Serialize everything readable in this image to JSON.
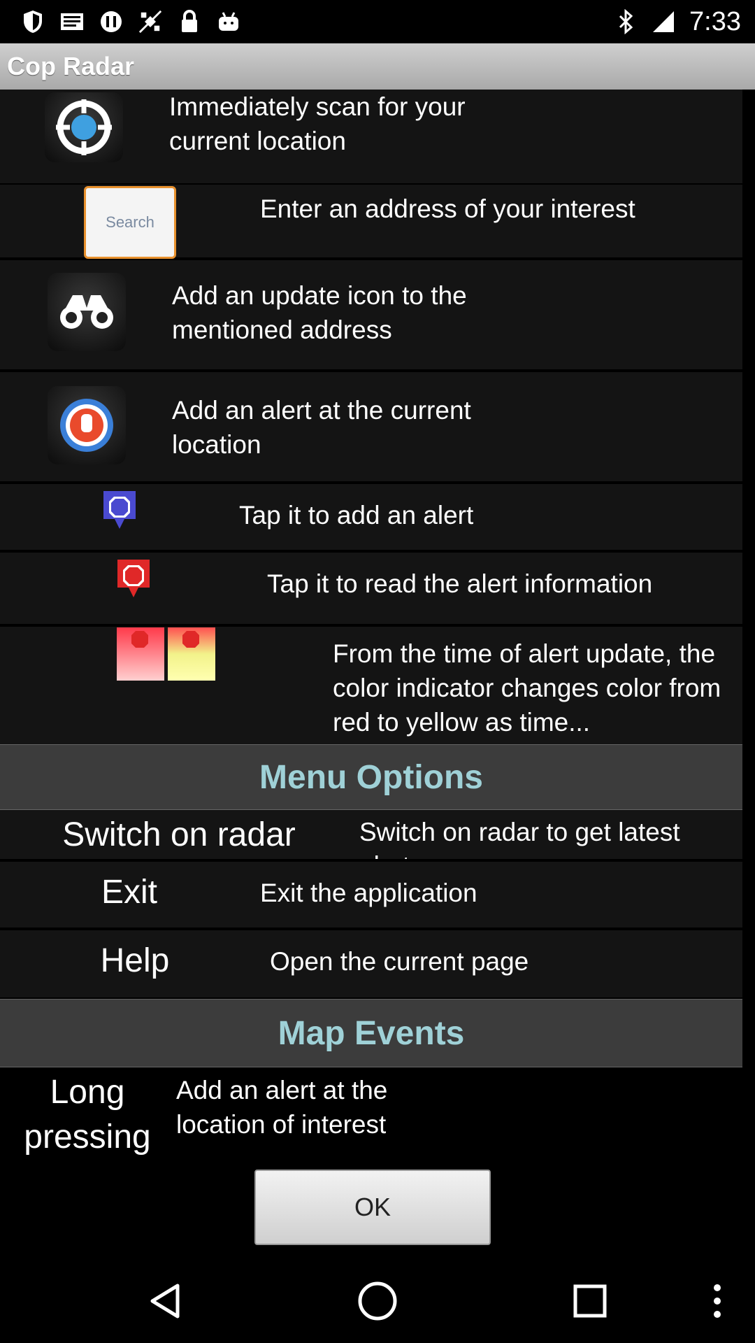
{
  "status_bar": {
    "time": "7:33",
    "left_icons": [
      "shield-icon",
      "mail-icon",
      "sync-icon",
      "gps-off-icon",
      "lock-icon",
      "android-icon"
    ],
    "right_icons": [
      "bluetooth-icon",
      "signal-icon"
    ]
  },
  "app": {
    "title": "Cop Radar"
  },
  "features": [
    {
      "icon": "radar-target-icon",
      "text": "Immediately scan for your current location"
    },
    {
      "icon": "search-button-icon",
      "icon_label": "Search",
      "text": "Enter an address of your interest"
    },
    {
      "icon": "binoculars-icon",
      "text": "Add an update icon to the mentioned address"
    },
    {
      "icon": "hand-stop-icon",
      "text": "Add an alert at the current location"
    },
    {
      "icon": "stop-marker-blue-icon",
      "text": "Tap it to add an alert"
    },
    {
      "icon": "stop-marker-red-icon",
      "text": "Tap it to read the alert information"
    },
    {
      "icon": "color-indicator-icons",
      "text": "From the time of alert update, the color indicator changes color from red to yellow as time..."
    }
  ],
  "menu_options": {
    "title": "Menu Options",
    "items": [
      {
        "name": "Switch on radar",
        "desc": "Switch on radar to get latest alerts"
      },
      {
        "name": "Exit",
        "desc": "Exit the application"
      },
      {
        "name": "Help",
        "desc": "Open the current page"
      }
    ]
  },
  "map_events": {
    "title": "Map Events",
    "items": [
      {
        "name": "Long pressing",
        "desc": "Add an alert at the location of interest"
      }
    ]
  },
  "ok_button": {
    "label": "OK"
  },
  "nav_bar": {
    "buttons": [
      "back-icon",
      "home-icon",
      "recents-icon",
      "overflow-menu-icon"
    ]
  },
  "colors": {
    "title_bar": "#b8b8b8",
    "section_header": "#3c3c3c",
    "section_text": "#9fd1d7",
    "row_bg": "#141414"
  }
}
